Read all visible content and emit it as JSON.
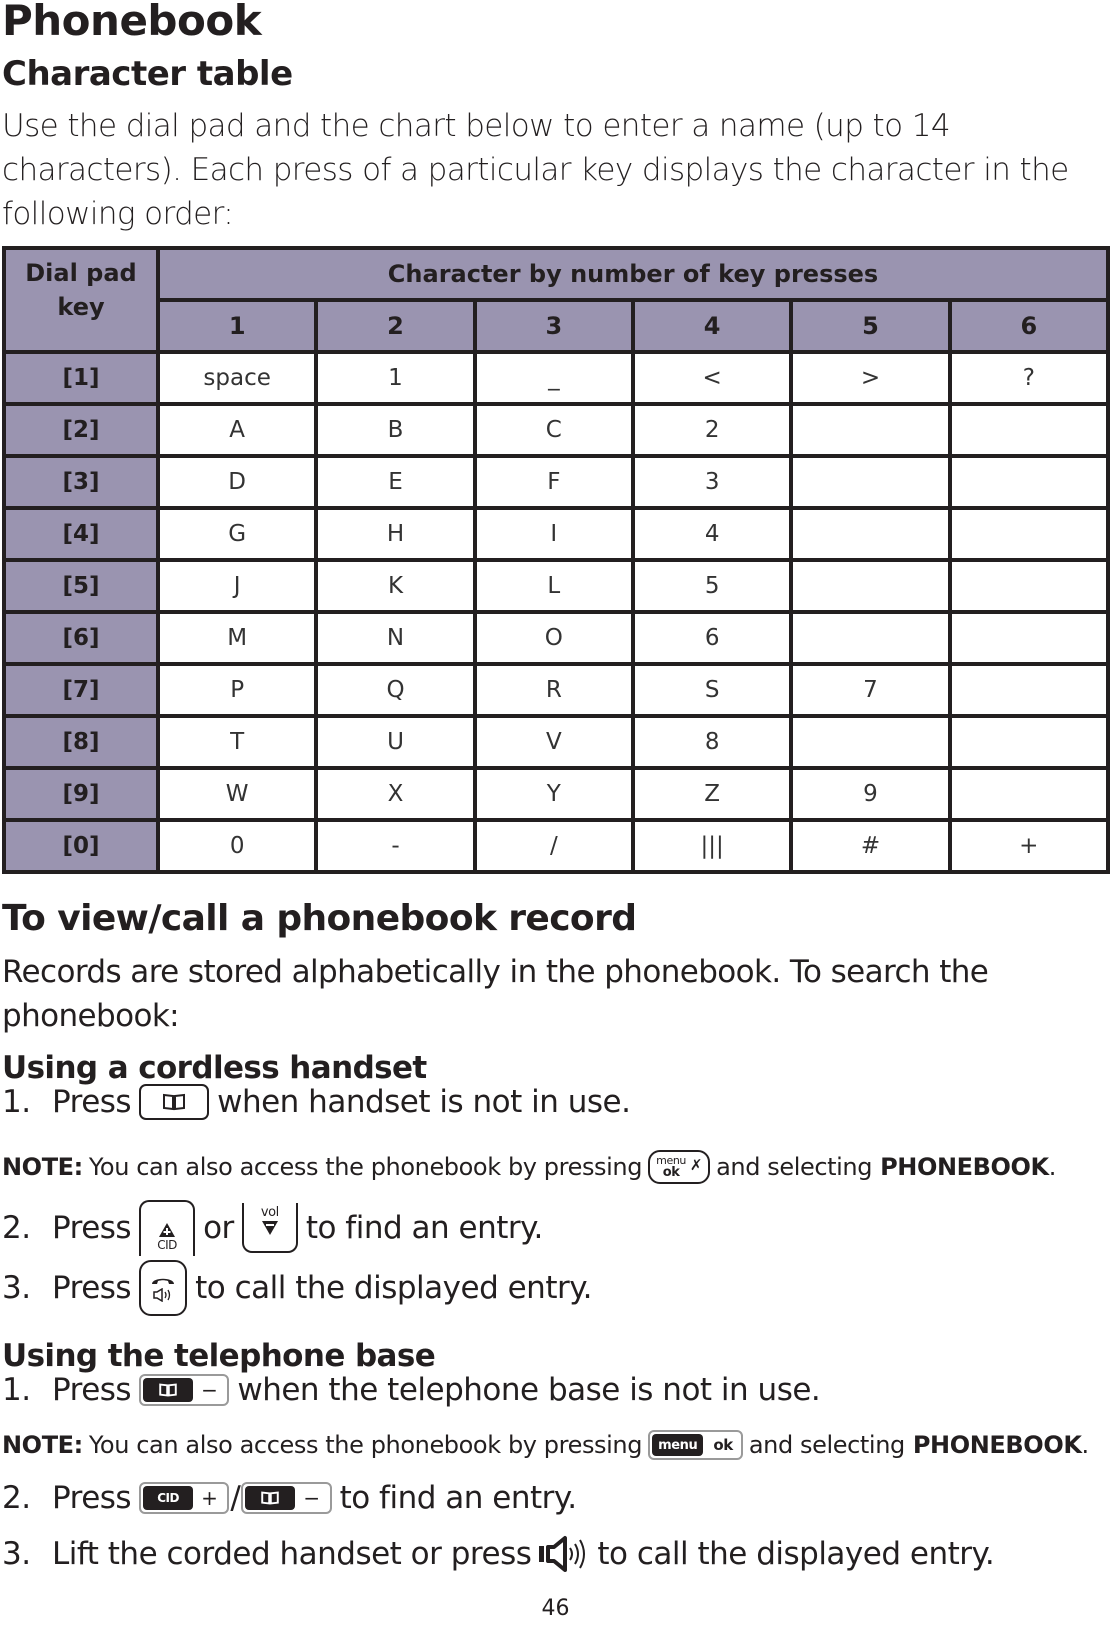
{
  "page": {
    "title": "Phonebook",
    "section_title": "Character table",
    "intro": "Use the dial pad and the chart below to enter a name (up to 14 characters). Each press of a particular key displays the character in the following order:",
    "page_number": "46"
  },
  "table": {
    "header_key": "Dial pad key",
    "header_group": "Character by number of key presses",
    "press_columns": [
      "1",
      "2",
      "3",
      "4",
      "5",
      "6"
    ],
    "header_color": "#9a94b0",
    "rows": [
      {
        "key": "[1]",
        "chars": [
          "space",
          "1",
          "_",
          "<",
          ">",
          "?"
        ]
      },
      {
        "key": "[2]",
        "chars": [
          "A",
          "B",
          "C",
          "2",
          "",
          ""
        ]
      },
      {
        "key": "[3]",
        "chars": [
          "D",
          "E",
          "F",
          "3",
          "",
          ""
        ]
      },
      {
        "key": "[4]",
        "chars": [
          "G",
          "H",
          "I",
          "4",
          "",
          ""
        ]
      },
      {
        "key": "[5]",
        "chars": [
          "J",
          "K",
          "L",
          "5",
          "",
          ""
        ]
      },
      {
        "key": "[6]",
        "chars": [
          "M",
          "N",
          "O",
          "6",
          "",
          ""
        ]
      },
      {
        "key": "[7]",
        "chars": [
          "P",
          "Q",
          "R",
          "S",
          "7",
          ""
        ]
      },
      {
        "key": "[8]",
        "chars": [
          "T",
          "U",
          "V",
          "8",
          "",
          ""
        ]
      },
      {
        "key": "[9]",
        "chars": [
          "W",
          "X",
          "Y",
          "Z",
          "9",
          ""
        ]
      },
      {
        "key": "[0]",
        "chars": [
          "0",
          "-",
          "/",
          "|||",
          "#",
          "+"
        ]
      }
    ]
  },
  "view": {
    "title": "To view/call a phonebook record",
    "para": "Records are stored alphabetically in the phonebook. To search the phonebook:",
    "handset": {
      "title": "Using a cordless handset",
      "step1": {
        "num": "1.",
        "pre": "Press",
        "post": "when handset is not in use.",
        "icon": "phonebook-key-icon"
      },
      "note": {
        "label": "NOTE:",
        "pre": "You can also access the phonebook by pressing",
        "mid": "and selecting",
        "bold": "PHONEBOOK",
        "end": ".",
        "key_top": "menu",
        "key_bottom": "ok",
        "icon": "menu-ok-mute-key-icon"
      },
      "step2": {
        "num": "2.",
        "pre": "Press",
        "or": "or",
        "post": "to find an entry.",
        "cid_label": "CID",
        "vol_label": "vol"
      },
      "step3": {
        "num": "3.",
        "pre": "Press",
        "post": "to call the displayed entry.",
        "icon": "talk-speaker-key-icon"
      }
    },
    "base": {
      "title": "Using the telephone base",
      "step1": {
        "num": "1.",
        "pre": "Press",
        "post": "when the telephone base is not in use.",
        "minus": "−"
      },
      "note": {
        "label": "NOTE:",
        "pre": "You can also access the phonebook by pressing",
        "mid": "and selecting",
        "bold": "PHONEBOOK",
        "end": ".",
        "key_left": "menu",
        "key_right": "ok"
      },
      "step2": {
        "num": "2.",
        "pre": "Press",
        "slash": "/",
        "post": "to find an entry.",
        "cid_label": "CID",
        "plus": "+",
        "minus": "−"
      },
      "step3": {
        "num": "3.",
        "pre": "Lift the corded handset or press",
        "post": "to call the displayed entry."
      }
    }
  }
}
